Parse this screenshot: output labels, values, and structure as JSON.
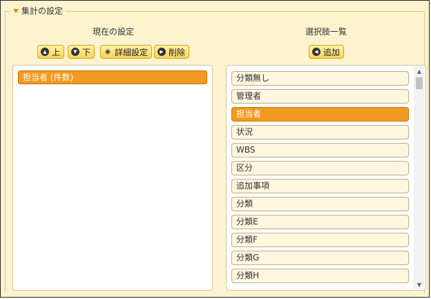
{
  "section": {
    "title": "集計の設定"
  },
  "current": {
    "title": "現在の設定",
    "buttons": {
      "up": "上",
      "down": "下",
      "detail": "詳細設定",
      "delete": "削除"
    },
    "items": [
      "担当者 (件数)"
    ]
  },
  "choices": {
    "title": "選択肢一覧",
    "add_label": "追加",
    "items": [
      "分類無し",
      "管理者",
      "担当者",
      "状況",
      "WBS",
      "区分",
      "追加事項",
      "分類",
      "分類E",
      "分類F",
      "分類G",
      "分類H"
    ],
    "selected": "担当者"
  },
  "colors": {
    "accent": "#f19a21",
    "button": "#f6d45a",
    "background": "#fdf3cf"
  }
}
